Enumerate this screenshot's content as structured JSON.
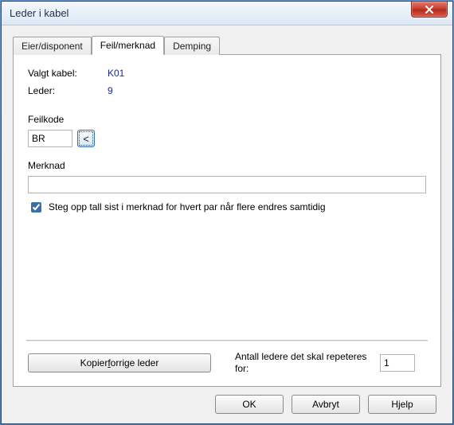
{
  "window": {
    "title": "Leder i kabel"
  },
  "tabs": [
    {
      "label": "Eier/disponent",
      "active": false
    },
    {
      "label": "Feil/merknad",
      "active": true
    },
    {
      "label": "Demping",
      "active": false
    }
  ],
  "selected": {
    "kabel_label": "Valgt kabel:",
    "kabel_value": "K01",
    "leder_label": "Leder:",
    "leder_value": "9"
  },
  "feilkode": {
    "label": "Feilkode",
    "value": "BR",
    "picker_label": "<"
  },
  "merknad": {
    "label": "Merknad",
    "value": "",
    "step_checked": true,
    "step_label": "Steg opp tall sist i merknad for hvert par når flere endres samtidig"
  },
  "copy": {
    "button_prefix": "Kopier ",
    "button_key": "f",
    "button_suffix": "orrige leder",
    "repeat_label": "Antall ledere det skal repeteres for:",
    "repeat_value": "1"
  },
  "buttons": {
    "ok": "OK",
    "cancel": "Avbryt",
    "help": "Hjelp"
  }
}
